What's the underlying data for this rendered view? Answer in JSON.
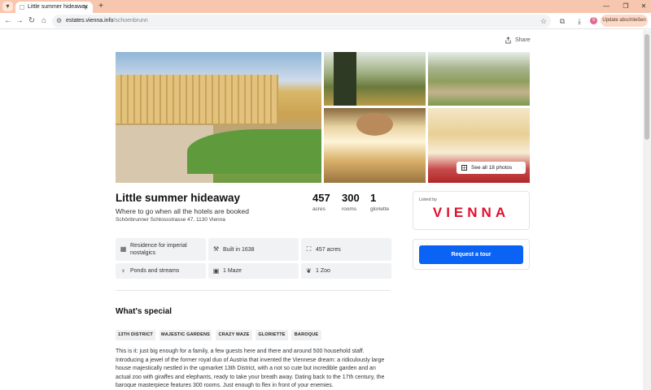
{
  "browser": {
    "tab_title": "Little summer hideaway",
    "url_host": "estates.vienna.info",
    "url_path": "/schoenbrunn",
    "update_label": "Update abschließen",
    "profile_initial": "S"
  },
  "page": {
    "share_label": "Share",
    "see_all_label": "See all 18 photos",
    "title": "Little summer hideaway",
    "subtitle": "Where to go when all the hotels are booked",
    "address": "Schönbrunner Schlossstrasse 47, 1130 Vienna",
    "stats": [
      {
        "value": "457",
        "label": "acres"
      },
      {
        "value": "300",
        "label": "rooms"
      },
      {
        "value": "1",
        "label": "gloriette"
      }
    ],
    "features": [
      {
        "icon": "building-icon",
        "text": "Residence for imperial nostalgics"
      },
      {
        "icon": "hammer-icon",
        "text": "Built in 1638"
      },
      {
        "icon": "area-icon",
        "text": "457 acres"
      },
      {
        "icon": "fountain-icon",
        "text": "Ponds and streams"
      },
      {
        "icon": "maze-icon",
        "text": "1 Maze"
      },
      {
        "icon": "animal-icon",
        "text": "1 Zoo"
      }
    ],
    "special_heading": "What's special",
    "tags": [
      "13TH DISTRICT",
      "MAJESTIC GARDENS",
      "CRAZY MAZE",
      "GLORIETTE",
      "BAROQUE"
    ],
    "description": "This is it: just big enough for a family, a few guests here and there and around 500 household staff. Introducing a jewel of the former royal duo of Austria that invented the Viennese dream: a ridiculously large house majestically nestled in the upmarket 13th District, with a not so cute but incredible garden and an actual zoo with giraffes and elephants, ready to take your breath away. Dating back to the 17th century, the baroque masterpiece features 300 rooms. Just enough to flex in front of your enemies.",
    "listed_by_label": "Listed by",
    "listed_by_logo": "VIENNA",
    "tour_button": "Request a tour"
  },
  "colors": {
    "tabstrip": "#f6c7ae",
    "brand_red": "#e0102e",
    "cta_blue": "#0b63f6"
  }
}
